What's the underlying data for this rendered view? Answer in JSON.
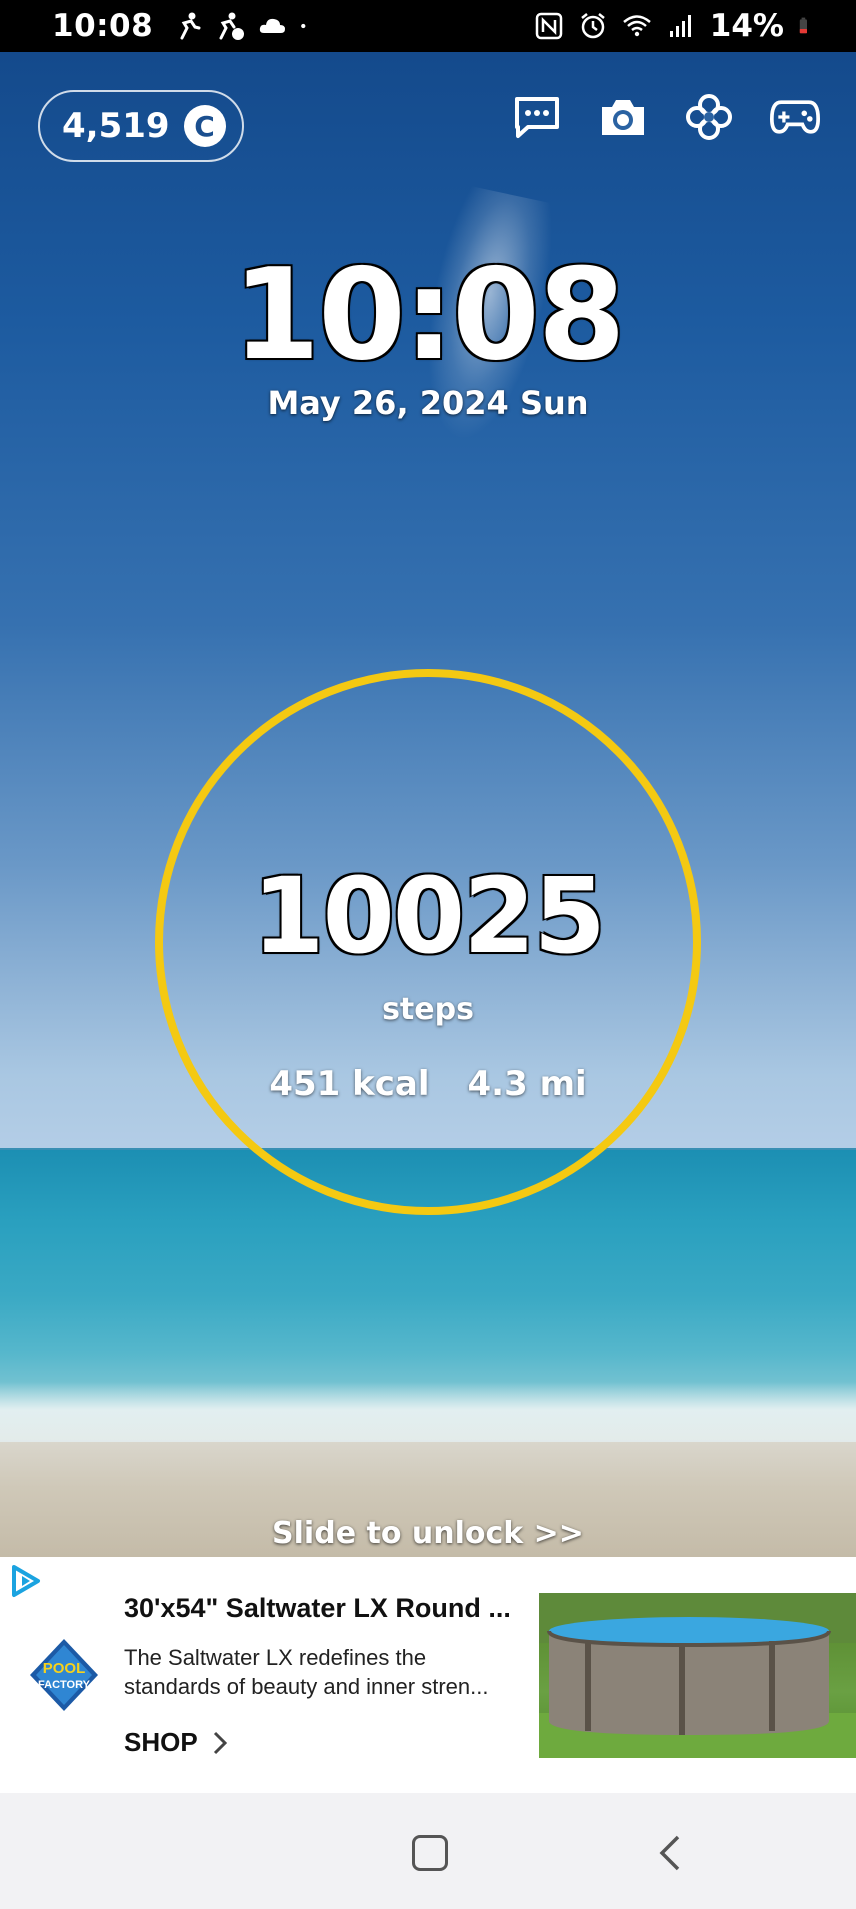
{
  "status_bar": {
    "time": "10:08",
    "battery": "14%",
    "left_icons": [
      "runner-icon",
      "runner-c-icon",
      "cloud-icon",
      "dot-icon"
    ],
    "right_icons": [
      "nfc-icon",
      "alarm-icon",
      "wifi-icon",
      "signal-icon",
      "battery-icon"
    ],
    "battery_color": "#e53935"
  },
  "lock": {
    "coins": "4,519",
    "coin_symbol": "C",
    "clock": "10:08",
    "date": "May 26, 2024 Sun",
    "steps": "10025",
    "steps_label": "steps",
    "kcal": "451 kcal",
    "distance": "4.3 mi",
    "slide_text": "Slide to unlock >>",
    "ring_color": "#f4c912",
    "top_icons": [
      "chat-icon",
      "camera-icon",
      "clover-icon",
      "gamepad-icon"
    ]
  },
  "ad": {
    "title": "30'x54\" Saltwater LX Round ...",
    "description": "The Saltwater LX redefines the standards of beauty and inner stren...",
    "cta": "SHOP",
    "logo_line1": "POOL",
    "logo_line2": "FACTORY"
  },
  "nav": {
    "icons": [
      "home-icon",
      "back-icon"
    ]
  }
}
